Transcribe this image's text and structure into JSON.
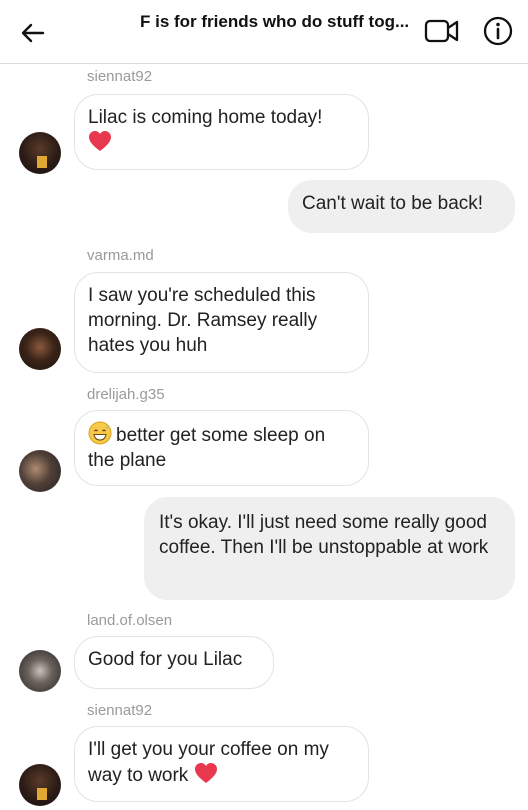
{
  "header": {
    "title": "F is for friends who do stuff tog...",
    "back_icon": "arrow-left-icon",
    "video_icon": "video-camera-icon",
    "info_icon": "info-icon"
  },
  "messages": [
    {
      "sender": "siennat92",
      "text": "Lilac is coming home today!",
      "direction": "in",
      "emoji": "heart"
    },
    {
      "text": "Can't wait to be back!",
      "direction": "out"
    },
    {
      "sender": "varma.md",
      "text": "I saw you're scheduled this morning. Dr. Ramsey really hates you huh",
      "direction": "in"
    },
    {
      "sender": "drelijah.g35",
      "text": "better get some sleep on the plane",
      "direction": "in",
      "emoji": "grinning-sweat"
    },
    {
      "text": "It's okay. I'll just need some really good coffee. Then I'll be unstoppable at work",
      "direction": "out"
    },
    {
      "sender": "land.of.olsen",
      "text": "Good for you Lilac",
      "direction": "in"
    },
    {
      "sender": "siennat92",
      "text": "I'll get you your coffee on my way to work",
      "direction": "in",
      "emoji": "heart"
    }
  ],
  "colors": {
    "incoming_bg": "#ffffff",
    "incoming_border": "#e3e3e3",
    "outgoing_bg": "#efefef",
    "username": "#9a9a9a",
    "heart": "#e8384f"
  }
}
